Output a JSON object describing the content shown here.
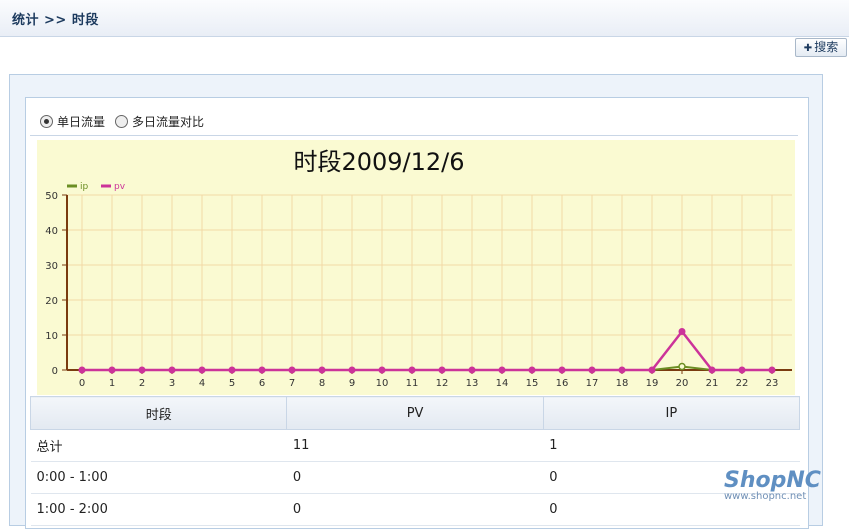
{
  "header": {
    "breadcrumb": "统计  >> 时段"
  },
  "toolbar": {
    "search_label": "搜索"
  },
  "mode_options": [
    {
      "label": "单日流量",
      "checked": true
    },
    {
      "label": "多日流量对比",
      "checked": false
    }
  ],
  "chart_data": {
    "type": "line",
    "title": "时段2009/12/6",
    "x": [
      0,
      1,
      2,
      3,
      4,
      5,
      6,
      7,
      8,
      9,
      10,
      11,
      12,
      13,
      14,
      15,
      16,
      17,
      18,
      19,
      20,
      21,
      22,
      23
    ],
    "ylim": [
      0,
      50
    ],
    "yticks": [
      0,
      10,
      20,
      30,
      40,
      50
    ],
    "grid": true,
    "legend": "top-left",
    "background": "#fafad2",
    "series": [
      {
        "name": "ip",
        "color": "#6b8e23",
        "values": [
          0,
          0,
          0,
          0,
          0,
          0,
          0,
          0,
          0,
          0,
          0,
          0,
          0,
          0,
          0,
          0,
          0,
          0,
          0,
          0,
          1,
          0,
          0,
          0
        ]
      },
      {
        "name": "pv",
        "color": "#cc3399",
        "values": [
          0,
          0,
          0,
          0,
          0,
          0,
          0,
          0,
          0,
          0,
          0,
          0,
          0,
          0,
          0,
          0,
          0,
          0,
          0,
          0,
          11,
          0,
          0,
          0
        ]
      }
    ]
  },
  "table": {
    "headers": [
      "时段",
      "PV",
      "IP"
    ],
    "rows": [
      [
        "总计",
        "11",
        "1"
      ],
      [
        "0:00 - 1:00",
        "0",
        "0"
      ],
      [
        "1:00 - 2:00",
        "0",
        "0"
      ]
    ]
  },
  "watermark": {
    "brand": "ShopNC",
    "url": "www.shopnc.net"
  }
}
